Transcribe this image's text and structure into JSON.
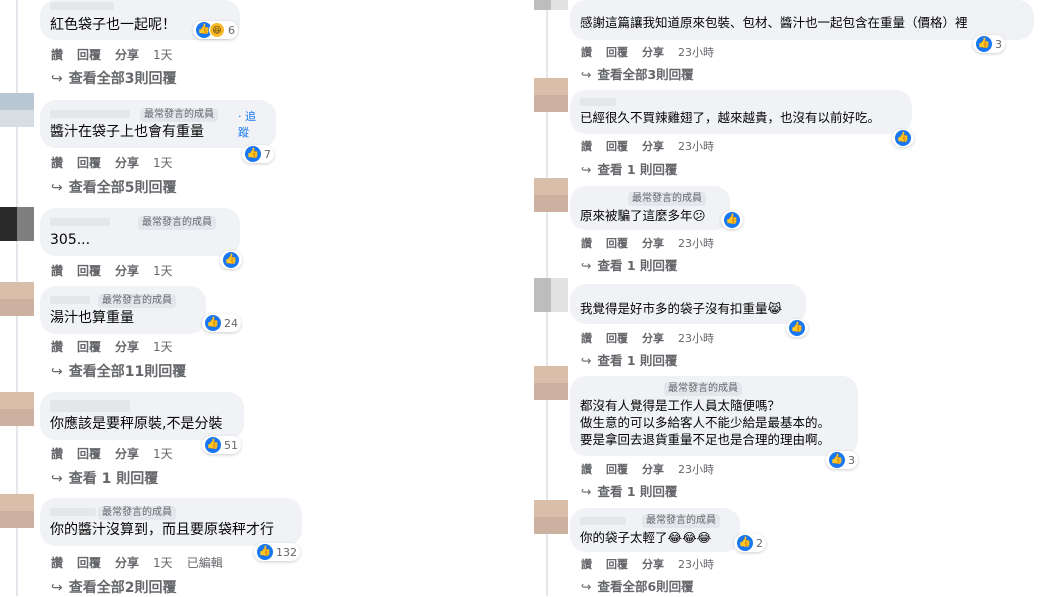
{
  "left": {
    "c1": {
      "text": "紅色袋子也一起呢！",
      "reaction_count": "6",
      "actions": [
        "讚",
        "回覆",
        "分享"
      ],
      "time": "1天",
      "view_replies": "查看全部3則回覆"
    },
    "c2": {
      "badge": "最常發言的成員",
      "follow": "· 追蹤",
      "text": "醬汁在袋子上也會有重量",
      "reaction_count": "7",
      "actions": [
        "讚",
        "回覆",
        "分享"
      ],
      "time": "1天",
      "view_replies": "查看全部5則回覆"
    },
    "c3": {
      "badge": "最常發言的成員",
      "text": "305...",
      "reaction_count": "",
      "actions": [
        "讚",
        "回覆",
        "分享"
      ],
      "time": "1天"
    },
    "c4": {
      "badge": "最常發言的成員",
      "text": "湯汁也算重量",
      "reaction_count": "24",
      "actions": [
        "讚",
        "回覆",
        "分享"
      ],
      "time": "1天",
      "view_replies": "查看全部11則回覆"
    },
    "c5": {
      "text": "你應該是要秤原裝,不是分裝",
      "reaction_count": "51",
      "actions": [
        "讚",
        "回覆",
        "分享"
      ],
      "time": "1天",
      "view_replies": "查看 1 則回覆"
    },
    "c6": {
      "badge": "最常發言的成員",
      "text": "你的醬汁沒算到，而且要原袋秤才行",
      "reaction_count": "132",
      "actions": [
        "讚",
        "回覆",
        "分享"
      ],
      "time": "1天",
      "edited": "已編輯",
      "view_replies": "查看全部2則回覆"
    }
  },
  "right": {
    "c1": {
      "text": "感謝這篇讓我知道原來包裝、包材、醬汁也一起包含在重量（價格）裡",
      "reaction_count": "3",
      "actions": [
        "讚",
        "回覆",
        "分享"
      ],
      "time": "23小時",
      "view_replies": "查看全部3則回覆"
    },
    "c2": {
      "text": "已經很久不買辣雞翅了，越來越貴，也沒有以前好吃。",
      "reaction_count": "",
      "actions": [
        "讚",
        "回覆",
        "分享"
      ],
      "time": "23小時",
      "view_replies": "查看 1 則回覆"
    },
    "c3": {
      "badge": "最常發言的成員",
      "text": "原來被騙了這麼多年😕",
      "reaction_count": "",
      "actions": [
        "讚",
        "回覆",
        "分享"
      ],
      "time": "23小時",
      "view_replies": "查看 1 則回覆"
    },
    "c4": {
      "text": "我覺得是好市多的袋子沒有扣重量😹",
      "reaction_count": "",
      "actions": [
        "讚",
        "回覆",
        "分享"
      ],
      "time": "23小時",
      "view_replies": "查看 1 則回覆"
    },
    "c5": {
      "badge": "最常發言的成員",
      "line1": "都沒有人覺得是工作人員太隨便嗎？",
      "line2": "做生意的可以多給客人不能少給是最基本的。",
      "line3": "要是拿回去退貨重量不足也是合理的理由啊。",
      "reaction_count": "3",
      "actions": [
        "讚",
        "回覆",
        "分享"
      ],
      "time": "23小時",
      "view_replies": "查看 1 則回覆"
    },
    "c6": {
      "badge": "最常發言的成員",
      "text": "你的袋子太輕了😂😂😂",
      "reaction_count": "2",
      "actions": [
        "讚",
        "回覆",
        "分享"
      ],
      "time": "23小時",
      "view_replies": "查看全部6則回覆"
    }
  },
  "icons": {
    "like": "like-icon",
    "haha": "haha-icon",
    "reply_hook": "reply-arrow-icon"
  },
  "colors": {
    "bubble": "#f0f2f5",
    "like": "#1877f2",
    "muted": "#65676b"
  }
}
